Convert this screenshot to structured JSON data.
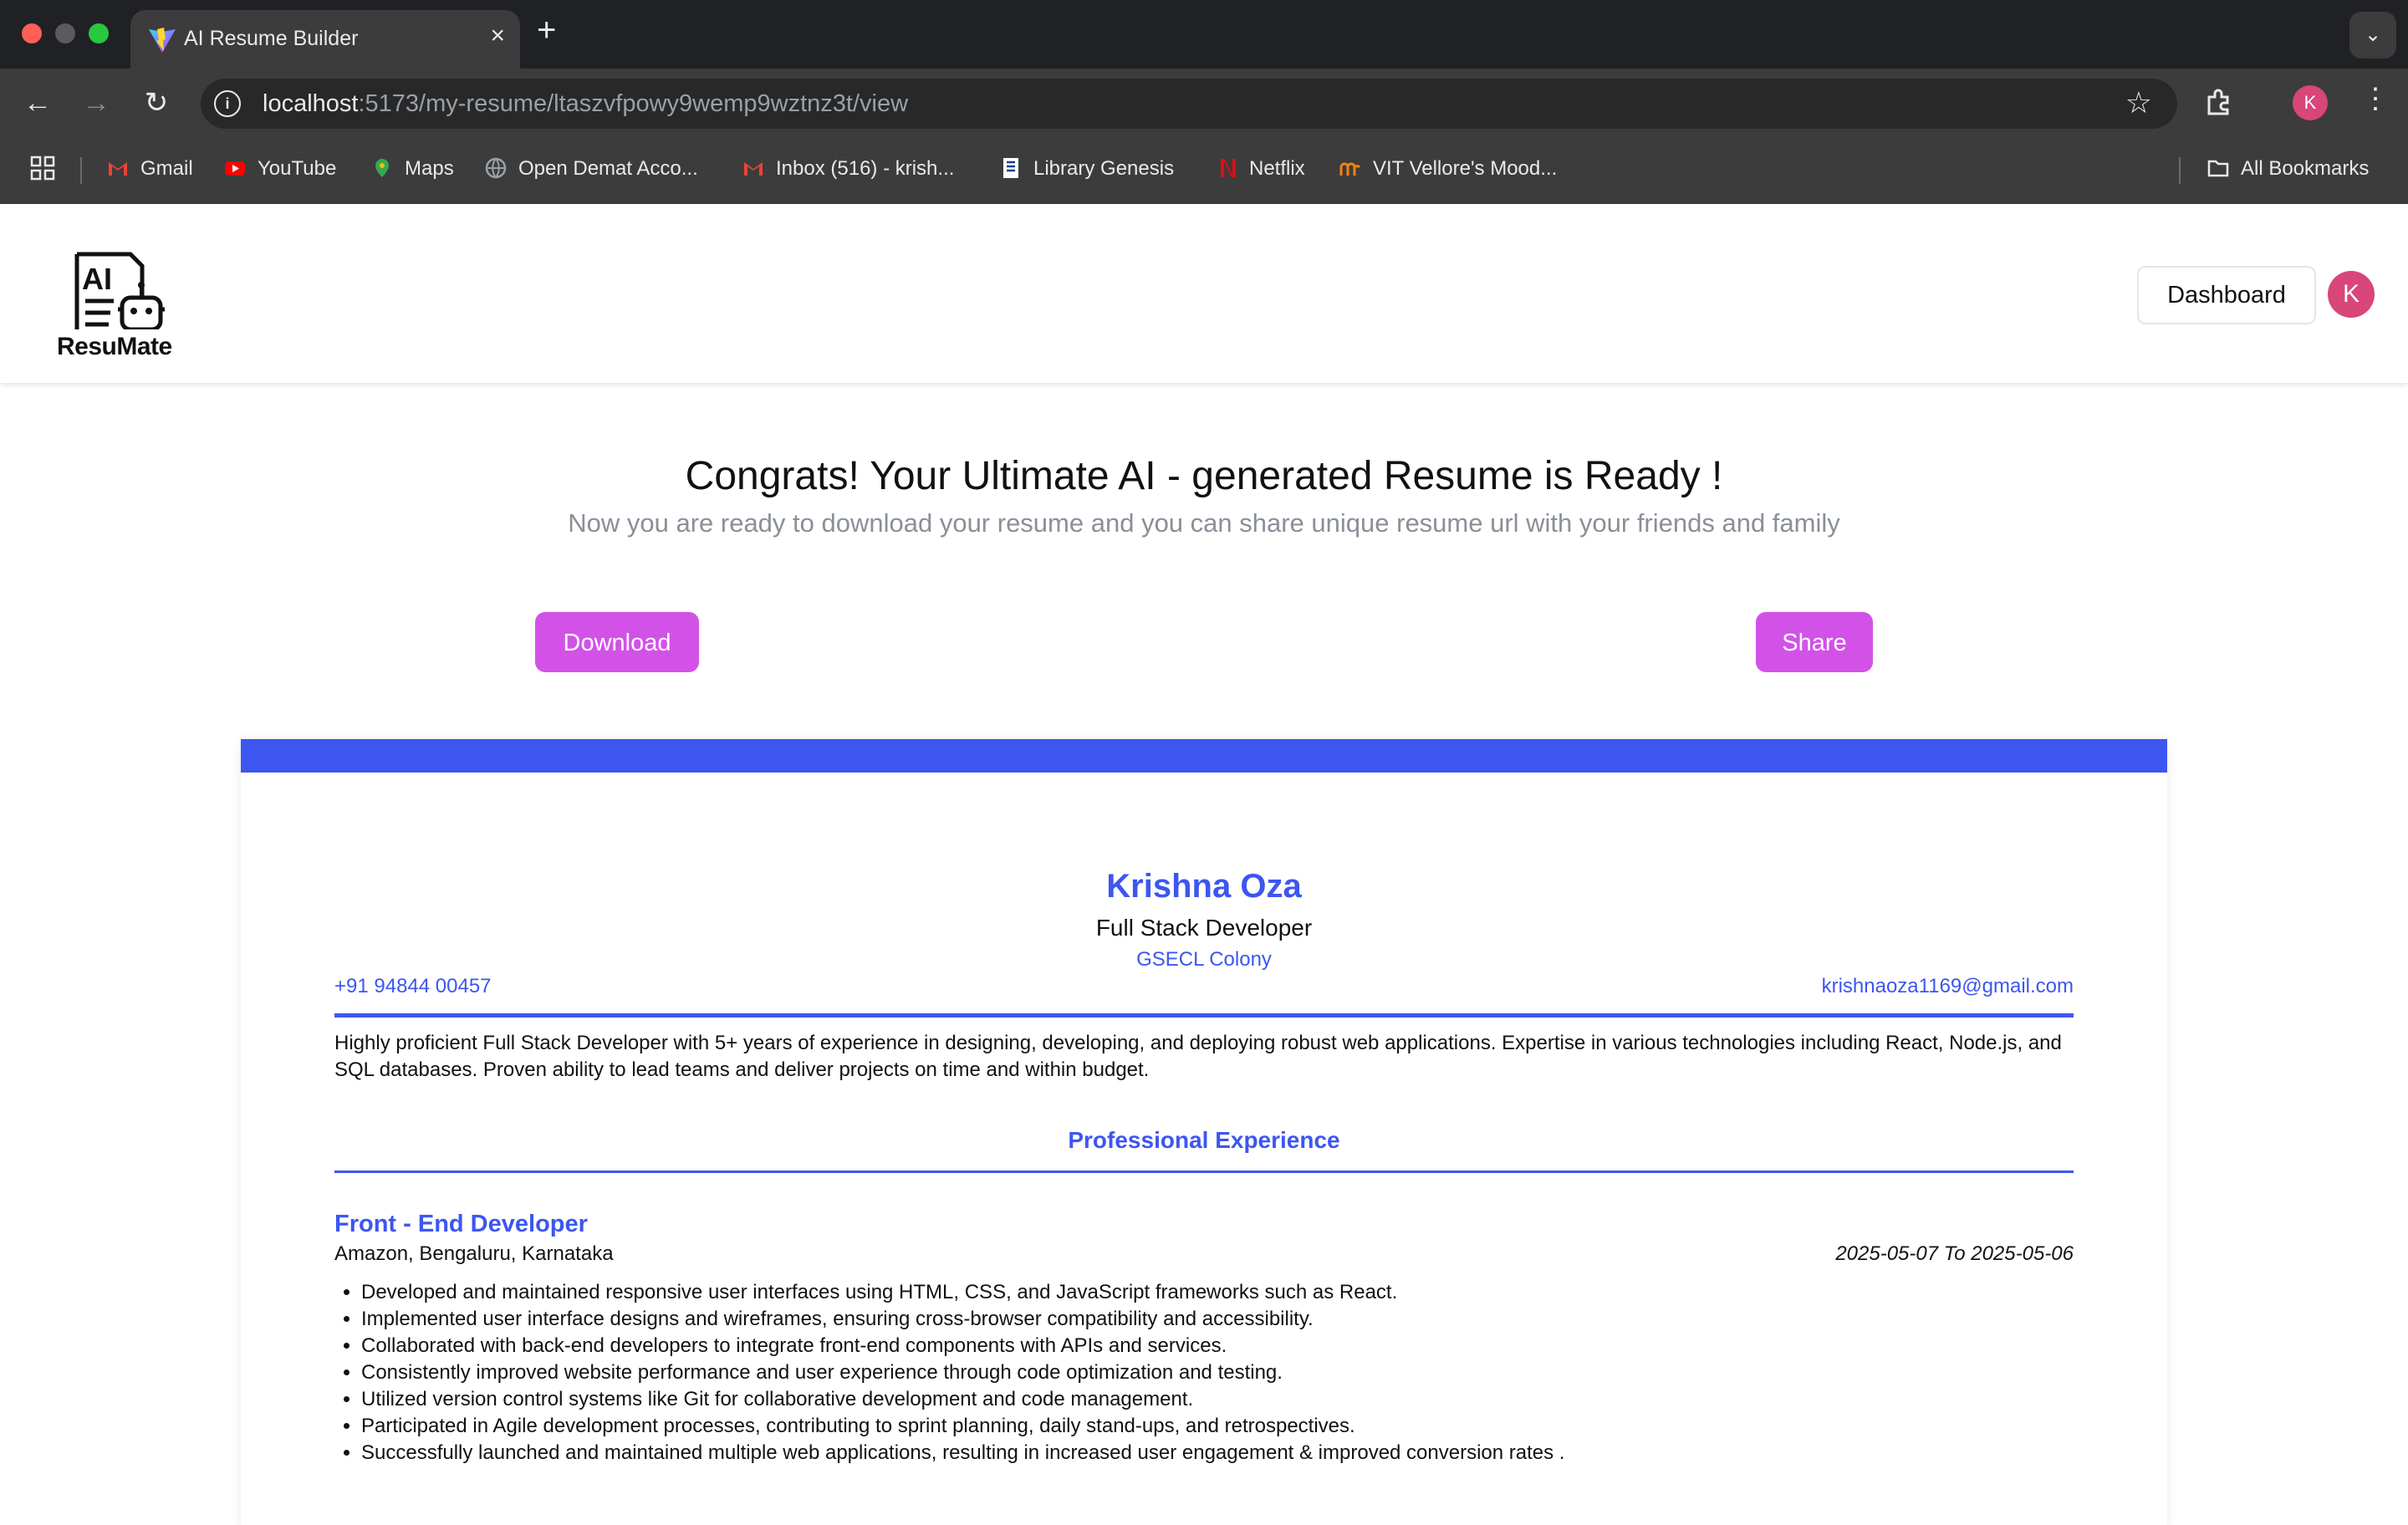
{
  "browser": {
    "tab_title": "AI Resume Builder",
    "tab_close": "×",
    "new_tab": "+",
    "tabs_menu": "⌄",
    "url_host": "localhost",
    "url_path": ":5173/my-resume/ltaszvfpowy9wemp9wztnz3t/view",
    "profile_initial": "K",
    "bookmarks": [
      {
        "label": "Gmail",
        "icon": "gmail-icon",
        "color": "#ea4335"
      },
      {
        "label": "YouTube",
        "icon": "youtube-icon",
        "color": "#ff0000"
      },
      {
        "label": "Maps",
        "icon": "maps-icon",
        "color": "#34a853"
      },
      {
        "label": "Open Demat Acco...",
        "icon": "globe-icon",
        "color": "#9aa0a6"
      },
      {
        "label": "Inbox (516) - krish...",
        "icon": "gmail-icon",
        "color": "#ea4335"
      },
      {
        "label": "Library Genesis",
        "icon": "book-icon",
        "color": "#ffffff"
      },
      {
        "label": "Netflix",
        "icon": "netflix-icon",
        "color": "#e50914"
      },
      {
        "label": "VIT Vellore's Mood...",
        "icon": "moodle-icon",
        "color": "#f98012"
      }
    ],
    "all_bookmarks": "All Bookmarks"
  },
  "app": {
    "logo_text": "ResuMate",
    "logo_badge": "AI",
    "dashboard_label": "Dashboard",
    "avatar_initial": "K",
    "congrats_title": "Congrats! Your Ultimate AI - generated Resume is Ready !",
    "congrats_sub": "Now you are ready to download your resume and you can share unique resume url with your friends and family",
    "download_label": "Download",
    "share_label": "Share",
    "accent": "#3d56f0",
    "cta_color": "#d252e8"
  },
  "resume": {
    "name": "Krishna Oza",
    "job_title": "Full Stack Developer",
    "address": "GSECL Colony",
    "phone": "+91 94844 00457",
    "email": "krishnaoza1169@gmail.com",
    "summary": "Highly proficient Full Stack Developer with 5+ years of experience in designing, developing, and deploying robust web applications. Expertise in various technologies including React, Node.js, and SQL databases. Proven ability to lead teams and deliver projects on time and within budget.",
    "section_experience": "Professional Experience",
    "experience": [
      {
        "title": "Front - End Developer",
        "company": "Amazon, Bengaluru, Karnataka",
        "dates": "2025-05-07 To 2025-05-06",
        "bullets": [
          "Developed and maintained responsive user interfaces using HTML, CSS, and JavaScript frameworks such as React.",
          "Implemented user interface designs and wireframes, ensuring cross-browser compatibility and accessibility.",
          "Collaborated with back-end developers to integrate front-end components with APIs and services.",
          "Consistently improved website performance and user experience through code optimization and testing.",
          "Utilized version control systems like Git for collaborative development and code management.",
          "Participated in Agile development processes, contributing to sprint planning, daily stand-ups, and retrospectives.",
          "Successfully launched and maintained multiple web applications, resulting in increased user engagement & improved conversion rates ."
        ]
      }
    ]
  }
}
